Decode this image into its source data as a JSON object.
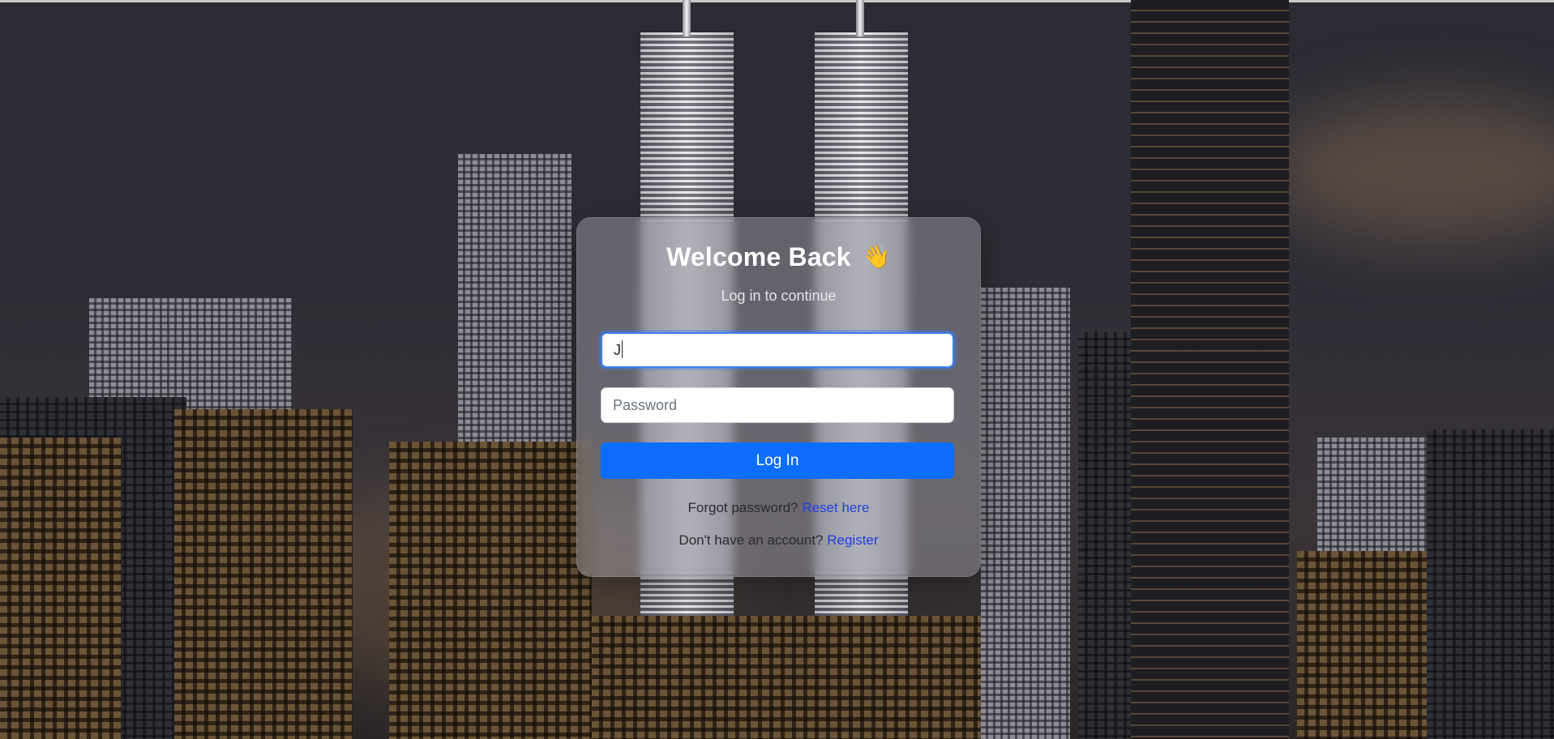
{
  "login": {
    "title": "Welcome Back",
    "title_emoji": "👋",
    "subtitle": "Log in to continue",
    "username_value": "J",
    "password_placeholder": "Password",
    "login_button": "Log In",
    "forgot_text": "Forgot password?",
    "forgot_link": "Reset here",
    "register_text": "Don't have an account?",
    "register_link": "Register"
  },
  "colors": {
    "primary_button": "#0d6efd",
    "link": "#1f3fe0",
    "focus_ring": "#3d7df5"
  }
}
